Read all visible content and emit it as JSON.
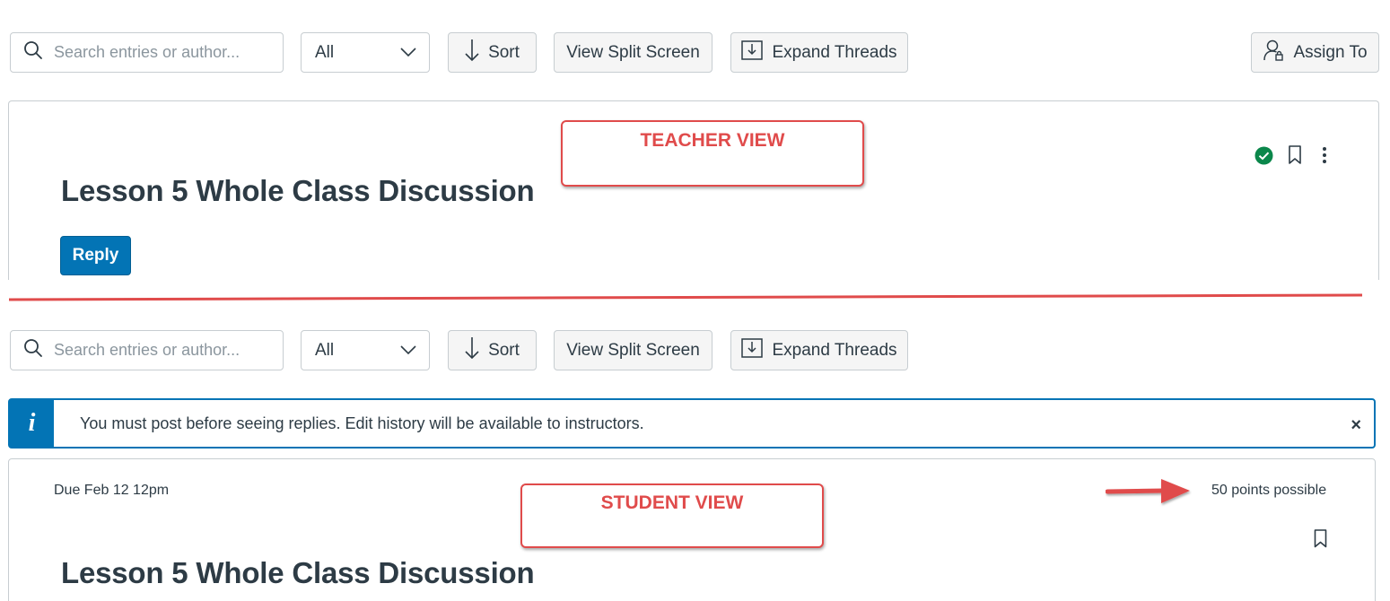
{
  "teacher": {
    "toolbar": {
      "search_placeholder": "Search entries or author...",
      "filter_value": "All",
      "sort_label": "Sort",
      "split_label": "View Split Screen",
      "expand_label": "Expand Threads",
      "assign_label": "Assign To"
    },
    "topic_title": "Lesson 5 Whole Class Discussion",
    "reply_label": "Reply",
    "annotation": "TEACHER VIEW"
  },
  "student": {
    "toolbar": {
      "search_placeholder": "Search entries or author...",
      "filter_value": "All",
      "sort_label": "Sort",
      "split_label": "View Split Screen",
      "expand_label": "Expand Threads"
    },
    "alert": {
      "icon": "i",
      "message": "You must post before seeing replies. Edit history will be available to instructors.",
      "close": "×"
    },
    "due": "Due Feb 12 12pm",
    "points": "50 points possible",
    "topic_title": "Lesson 5 Whole Class Discussion",
    "annotation": "STUDENT VIEW"
  },
  "colors": {
    "accent": "#0374b5",
    "annotation_red": "#e04b4b",
    "published_green": "#0b874b"
  }
}
